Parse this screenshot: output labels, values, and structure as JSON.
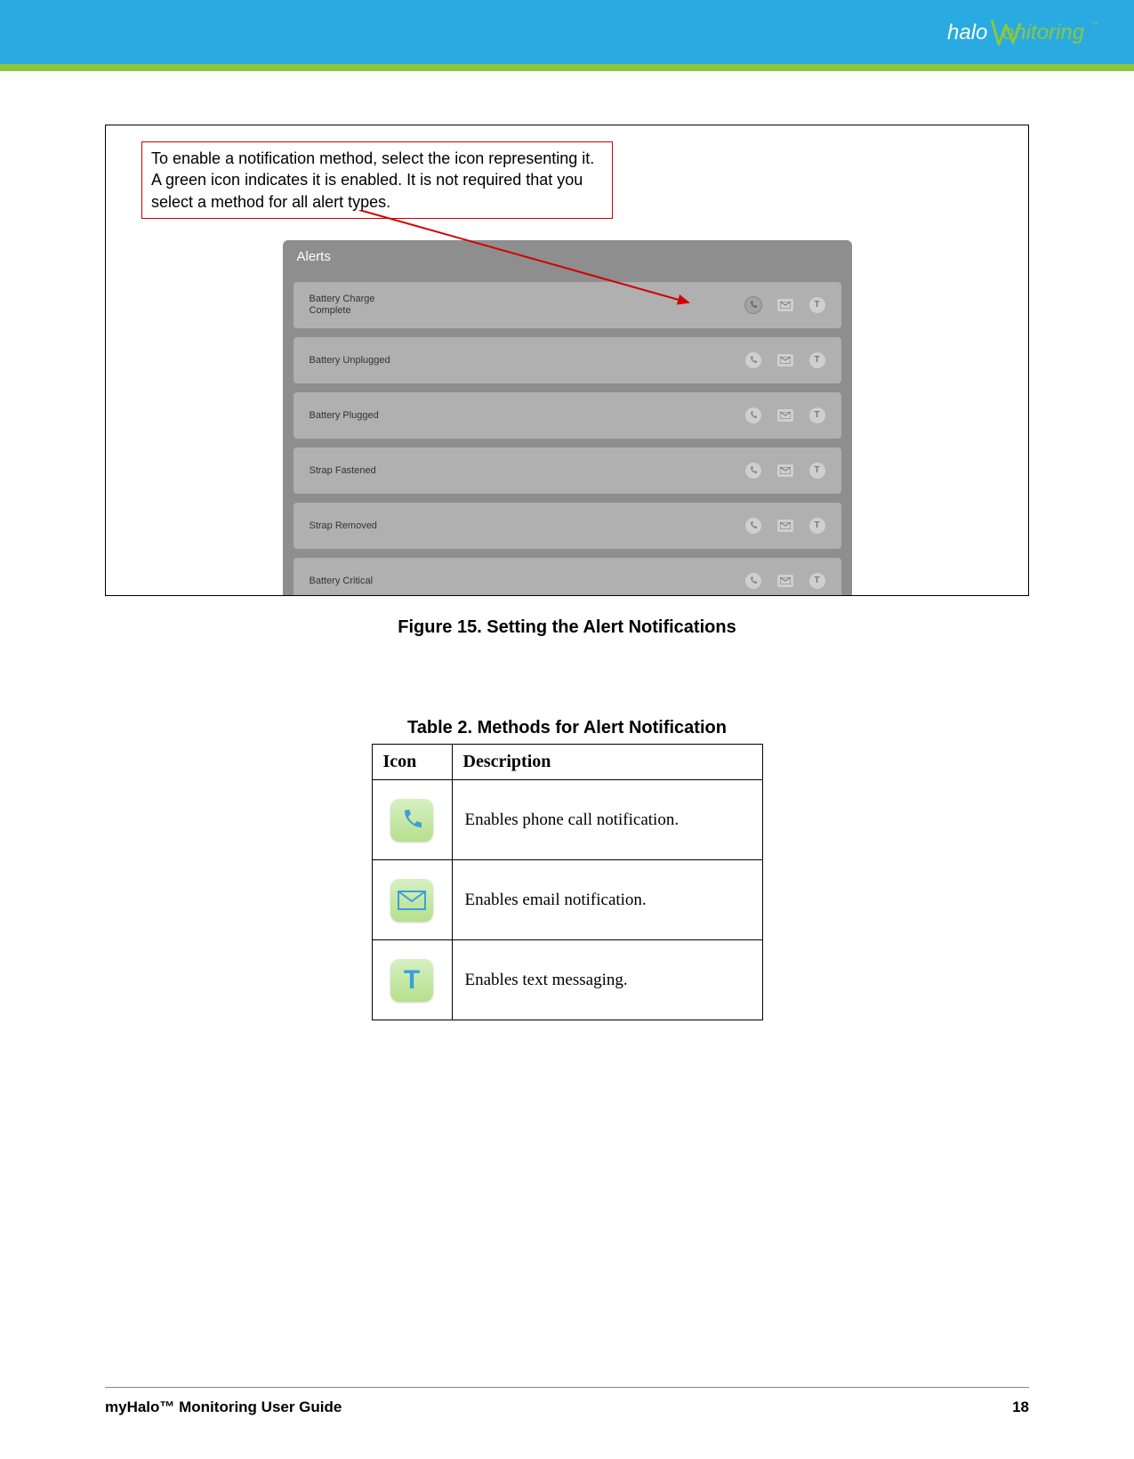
{
  "logo": {
    "text1": "halo",
    "text2": "onitoring",
    "tm": "™"
  },
  "callout": "To enable a notification method, select the icon representing it. A green icon indicates it is enabled. It is not required that you select a method for all alert types.",
  "alerts": {
    "header": "Alerts",
    "rows": [
      {
        "label": "Battery Charge\nComplete"
      },
      {
        "label": "Battery Unplugged"
      },
      {
        "label": "Battery Plugged"
      },
      {
        "label": "Strap Fastened"
      },
      {
        "label": "Strap Removed"
      },
      {
        "label": "Battery Critical"
      }
    ],
    "icon_names": {
      "phone": "phone-icon",
      "email": "email-icon",
      "text": "text-icon"
    }
  },
  "figure_caption": "Figure 15. Setting the Alert Notifications",
  "table_caption": "Table 2. Methods for Alert Notification",
  "table": {
    "headers": {
      "icon": "Icon",
      "desc": "Description"
    },
    "rows": [
      {
        "icon": "phone",
        "desc": "Enables phone call notification."
      },
      {
        "icon": "email",
        "desc": "Enables email notification."
      },
      {
        "icon": "text",
        "desc": "Enables text messaging."
      }
    ]
  },
  "footer": {
    "title": "myHalo™ Monitoring User Guide",
    "page": "18"
  }
}
